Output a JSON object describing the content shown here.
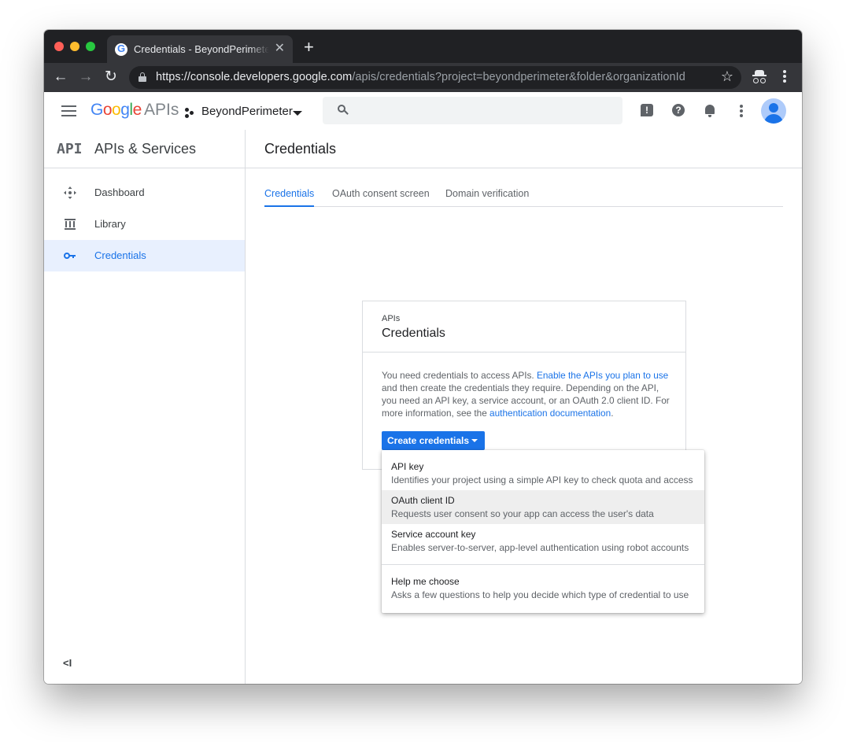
{
  "browser": {
    "tab_title": "Credentials - BeyondPerimeter",
    "tab_close": "✕",
    "new_tab": "+",
    "back": "←",
    "forward": "→",
    "reload": "↻",
    "url_main": "https://console.developers.google.com",
    "url_rest": "/apis/credentials?project=beyondperimeter&folder&organizationId",
    "star": "☆"
  },
  "header": {
    "logo": [
      "G",
      "o",
      "o",
      "g",
      "l",
      "e"
    ],
    "logo_suffix": "APIs",
    "project": "BeyondPerimeter",
    "feedback_icon": "!",
    "help_icon": "?"
  },
  "sidebar": {
    "logo": "API",
    "title": "APIs & Services",
    "items": [
      {
        "label": "Dashboard",
        "icon": "dashboard-icon"
      },
      {
        "label": "Library",
        "icon": "library-icon"
      },
      {
        "label": "Credentials",
        "icon": "key-icon",
        "active": true
      }
    ],
    "collapse": "<I"
  },
  "main": {
    "title": "Credentials",
    "tabs": [
      {
        "label": "Credentials",
        "active": true
      },
      {
        "label": "OAuth consent screen"
      },
      {
        "label": "Domain verification"
      }
    ],
    "card": {
      "kicker": "APIs",
      "title": "Credentials",
      "text_1": "You need credentials to access APIs. ",
      "link_1": "Enable the APIs you plan to use",
      "text_2": " and then create the credentials they require. Depending on the API, you need an API key, a service account, or an OAuth 2.0 client ID. For more information, see the ",
      "link_2": "authentication documentation",
      "text_3": ".",
      "button": "Create credentials"
    },
    "menu": [
      {
        "title": "API key",
        "desc": "Identifies your project using a simple API key to check quota and access"
      },
      {
        "title": "OAuth client ID",
        "desc": "Requests user consent so your app can access the user's data",
        "highlighted": true
      },
      {
        "title": "Service account key",
        "desc": "Enables server-to-server, app-level authentication using robot accounts"
      },
      {
        "title": "Help me choose",
        "desc": "Asks a few questions to help you decide which type of credential to use"
      }
    ]
  },
  "colors": {
    "accent": "#1a73e8",
    "active_bg": "#e8f0fe",
    "chrome_dark": "#202124"
  }
}
